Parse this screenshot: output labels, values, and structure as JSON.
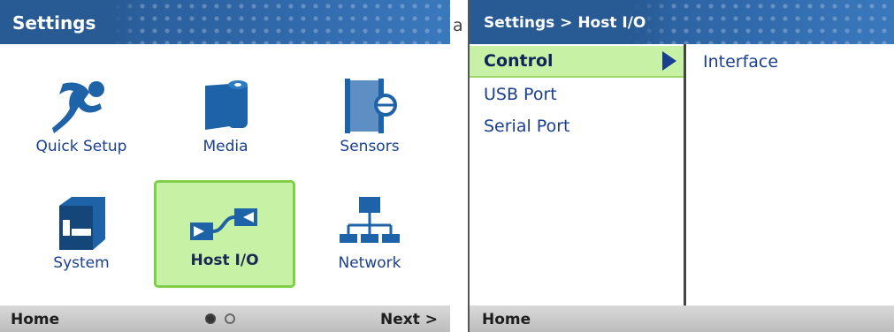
{
  "left_screen": {
    "title": "Settings",
    "tiles": [
      {
        "label": "Quick Setup",
        "icon": "runner-icon",
        "selected": false
      },
      {
        "label": "Media",
        "icon": "media-roll-icon",
        "selected": false
      },
      {
        "label": "Sensors",
        "icon": "sensor-icon",
        "selected": false
      },
      {
        "label": "System",
        "icon": "printer-icon",
        "selected": false
      },
      {
        "label": "Host I/O",
        "icon": "cable-connector-icon",
        "selected": true
      },
      {
        "label": "Network",
        "icon": "network-icon",
        "selected": false
      }
    ],
    "footer": {
      "home": "Home",
      "next": "Next >",
      "page_dots": [
        true,
        false
      ]
    }
  },
  "separator_label": "a",
  "right_screen": {
    "title": "Settings > Host I/O",
    "menu": [
      {
        "label": "Control",
        "selected": true
      },
      {
        "label": "USB Port",
        "selected": false
      },
      {
        "label": "Serial Port",
        "selected": false
      }
    ],
    "submenu": [
      {
        "label": "Interface"
      }
    ],
    "footer": {
      "home": "Home"
    }
  },
  "colors": {
    "titlebar": "#2a5d95",
    "selection_fill": "#c7f2a6",
    "selection_border": "#7fcf4b",
    "label_text": "#1a3f8f",
    "footer": "#c8c8c8"
  }
}
